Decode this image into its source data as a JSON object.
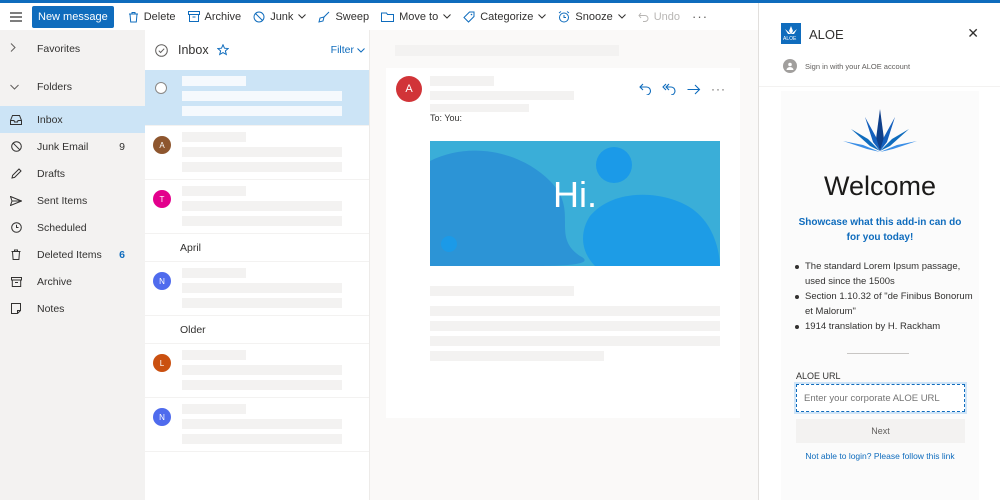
{
  "toolbar": {
    "new_message": "New message",
    "delete": "Delete",
    "archive": "Archive",
    "junk": "Junk",
    "sweep": "Sweep",
    "move_to": "Move to",
    "categorize": "Categorize",
    "snooze": "Snooze",
    "undo": "Undo",
    "more": "···"
  },
  "nav": {
    "favorites": "Favorites",
    "folders": "Folders",
    "items": [
      {
        "label": "Inbox",
        "count": ""
      },
      {
        "label": "Junk Email",
        "count": "9"
      },
      {
        "label": "Drafts",
        "count": ""
      },
      {
        "label": "Sent Items",
        "count": ""
      },
      {
        "label": "Scheduled",
        "count": ""
      },
      {
        "label": "Deleted Items",
        "count": "6"
      },
      {
        "label": "Archive",
        "count": ""
      },
      {
        "label": "Notes",
        "count": ""
      }
    ]
  },
  "list": {
    "title": "Inbox",
    "filter": "Filter",
    "groups": [
      "April",
      "Older"
    ],
    "avatars": [
      {
        "initial": "A",
        "color": "#8e562e"
      },
      {
        "initial": "T",
        "color": "#e3008c"
      },
      {
        "initial": "N",
        "color": "#4f6bed"
      },
      {
        "initial": "L",
        "color": "#ca5010"
      },
      {
        "initial": "N",
        "color": "#4f6bed"
      }
    ]
  },
  "reading": {
    "sender_initial": "A",
    "to_label": "To:",
    "to_value": "You:",
    "banner_text": "Hi."
  },
  "addin": {
    "title": "ALOE",
    "badge": "ALOE",
    "signin": "Sign in with your ALOE account",
    "welcome": "Welcome",
    "showcase": "Showcase what this add-in can do for you today!",
    "bullets": [
      "The standard Lorem Ipsum passage, used since the 1500s",
      "Section 1.10.32 of \"de Finibus Bonorum et Malorum\"",
      "1914 translation by H. Rackham"
    ],
    "url_label": "ALOE URL",
    "url_placeholder": "Enter your corporate ALOE URL",
    "next": "Next",
    "login_link": "Not able to login? Please follow this link"
  },
  "colors": {
    "accent": "#0f6cbd",
    "selected": "#cce4f6",
    "banner": "#3aaed8"
  }
}
